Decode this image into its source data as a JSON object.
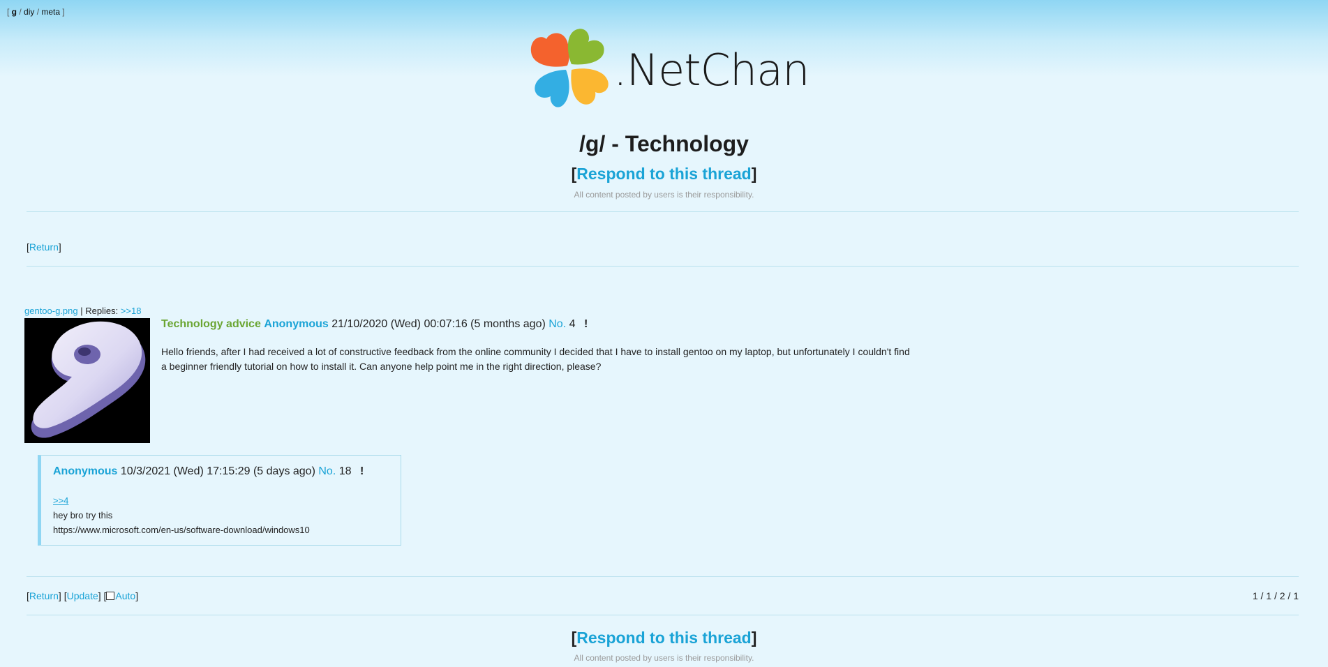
{
  "board_nav": {
    "boards": [
      "g",
      "diy",
      "meta"
    ],
    "current": "g"
  },
  "logo": {
    "text": ".NetChan"
  },
  "board_title": "/g/ - Technology",
  "respond_link": "Respond to this thread",
  "disclaimer": "All content posted by users is their responsibility.",
  "top_nav": {
    "return_label": "Return"
  },
  "op": {
    "file_name": "gentoo-g.png",
    "replies_label": "Replies:",
    "reply_link": ">>18",
    "subject": "Technology advice",
    "name": "Anonymous",
    "date": "21/10/2020 (Wed) 00:07:16 (5 months ago)",
    "no_label": "No.",
    "number": "4",
    "flag": "!",
    "body_line1": "Hello friends, after I had received a lot of constructive feedback from the online community I decided that I have to install gentoo on my laptop, but unfortunately I couldn't find",
    "body_line2": "a beginner friendly tutorial on how to install it. Can anyone help point me in the right direction, please?"
  },
  "reply": {
    "name": "Anonymous",
    "date": "10/3/2021 (Wed) 17:15:29 (5 days ago)",
    "no_label": "No.",
    "number": "18",
    "flag": "!",
    "quote": ">>4",
    "line1": "hey bro try this",
    "line2": "https://www.microsoft.com/en-us/software-download/windows10"
  },
  "bottom_nav": {
    "return_label": "Return",
    "update_label": "Update",
    "auto_label": "Auto",
    "auto_checked": false,
    "stats": "1 / 1 / 2 / 1"
  },
  "colors": {
    "link": "#1aa3d6",
    "subject": "#6aa532",
    "background": "#e6f6fd",
    "header_gradient_top": "#8fd6f3",
    "logo_petals": [
      "#f4622d",
      "#8ab832",
      "#33aee3",
      "#fbb731"
    ]
  }
}
